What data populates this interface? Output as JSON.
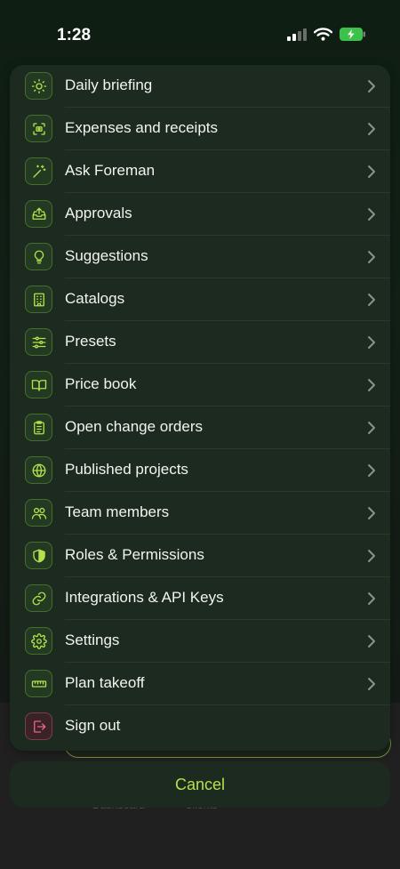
{
  "status_bar": {
    "time": "1:28",
    "icons": [
      "cellular-signal-icon",
      "wifi-icon",
      "battery-charging-icon"
    ]
  },
  "menu": {
    "items": [
      {
        "label": "Daily briefing",
        "icon": "sun-icon"
      },
      {
        "label": "Expenses and receipts",
        "icon": "receipt-scan-icon"
      },
      {
        "label": "Ask Foreman",
        "icon": "magic-wand-icon"
      },
      {
        "label": "Approvals",
        "icon": "inbox-upload-icon"
      },
      {
        "label": "Suggestions",
        "icon": "lightbulb-icon"
      },
      {
        "label": "Catalogs",
        "icon": "building-icon"
      },
      {
        "label": "Presets",
        "icon": "sliders-icon"
      },
      {
        "label": "Price book",
        "icon": "open-book-icon"
      },
      {
        "label": "Open change orders",
        "icon": "clipboard-icon"
      },
      {
        "label": "Published projects",
        "icon": "globe-icon"
      },
      {
        "label": "Team members",
        "icon": "users-icon"
      },
      {
        "label": "Roles & Permissions",
        "icon": "shield-icon"
      },
      {
        "label": "Integrations & API Keys",
        "icon": "link-icon"
      },
      {
        "label": "Settings",
        "icon": "gear-icon"
      },
      {
        "label": "Plan takeoff",
        "icon": "ruler-icon"
      },
      {
        "label": "Sign out",
        "icon": "sign-out-icon"
      }
    ]
  },
  "cancel_label": "Cancel",
  "background": {
    "tabs": [
      "Dashboard",
      "Clients"
    ]
  },
  "colors": {
    "accent": "#b6e04c",
    "sheet_bg": "#1c2a1f",
    "danger": "#e06a7e"
  }
}
